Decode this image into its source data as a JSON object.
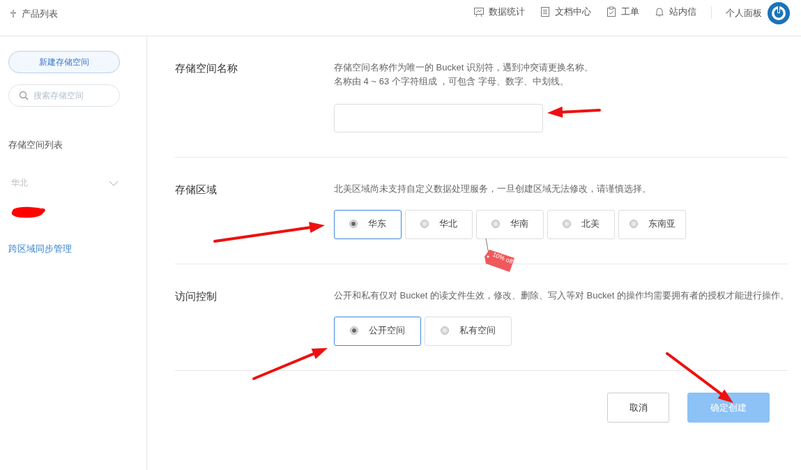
{
  "header": {
    "product_menu": "产品列表",
    "nav": [
      {
        "label": "数据统计"
      },
      {
        "label": "文档中心"
      },
      {
        "label": "工单"
      },
      {
        "label": "站内信"
      }
    ],
    "account": "个人面板"
  },
  "sidebar": {
    "new_button": "新建存储空间",
    "search": {
      "placeholder": "搜索存储空间"
    },
    "list_title": "存储空间列表",
    "region_filter": "华北",
    "sync_link": "跨区域同步管理"
  },
  "sections": [
    {
      "kind": "text",
      "label": "存储空间名称",
      "hint": [
        "存储空间名称作为唯一的 Bucket 识别符，遇到冲突请更换名称。",
        "名称由 4 ~ 63 个字符组成 ，可包含 字母、数字、中划线。"
      ]
    },
    {
      "kind": "options",
      "label": "存储区域",
      "hint": [
        "北美区域尚未支持自定义数据处理服务，一旦创建区域无法修改，请谨慎选择。"
      ],
      "options": [
        {
          "label": "华东",
          "selected": true
        },
        {
          "label": "华北",
          "selected": false
        },
        {
          "label": "华南",
          "selected": false,
          "badge": "10% off"
        },
        {
          "label": "北美",
          "selected": false
        },
        {
          "label": "东南亚",
          "selected": false
        }
      ]
    },
    {
      "kind": "options",
      "label": "访问控制",
      "hint": [
        "公开和私有仅对 Bucket 的读文件生效，修改、删除、写入等对 Bucket 的操作均需要拥有者的授权才能进行操作。"
      ],
      "options": [
        {
          "label": "公开空间",
          "selected": true
        },
        {
          "label": "私有空间",
          "selected": false
        }
      ]
    }
  ],
  "buttons": [
    {
      "label": "取消",
      "kind": "secondary",
      "disabled": false
    },
    {
      "label": "确定创建",
      "kind": "primary",
      "disabled": true
    }
  ]
}
